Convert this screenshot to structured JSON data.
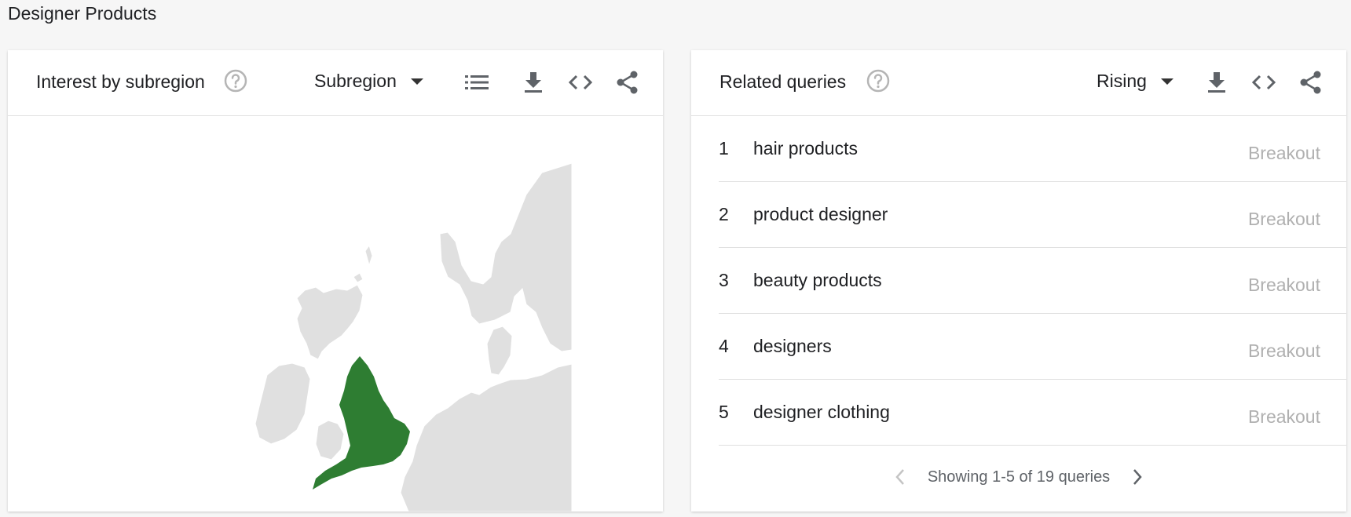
{
  "page": {
    "title": "Designer Products"
  },
  "subregion_card": {
    "title": "Interest by subregion",
    "dropdown_label": "Subregion",
    "icons": [
      "help-icon",
      "list-icon",
      "download-icon",
      "embed-code-icon",
      "share-icon"
    ],
    "highlight_color": "#2e7d32",
    "map_land_color": "#e0e0e0"
  },
  "queries_card": {
    "title": "Related queries",
    "dropdown_label": "Rising",
    "icons": [
      "help-icon",
      "download-icon",
      "embed-code-icon",
      "share-icon"
    ],
    "rows": [
      {
        "rank": "1",
        "query": "hair products",
        "value": "Breakout"
      },
      {
        "rank": "2",
        "query": "product designer",
        "value": "Breakout"
      },
      {
        "rank": "3",
        "query": "beauty products",
        "value": "Breakout"
      },
      {
        "rank": "4",
        "query": "designers",
        "value": "Breakout"
      },
      {
        "rank": "5",
        "query": "designer clothing",
        "value": "Breakout"
      }
    ],
    "pagination": "Showing 1-5 of 19 queries"
  }
}
